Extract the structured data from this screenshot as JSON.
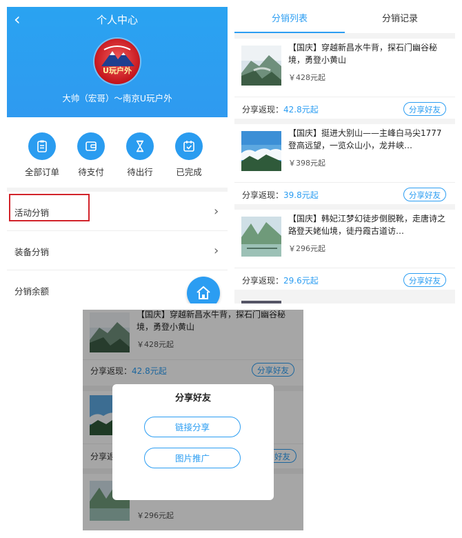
{
  "profile": {
    "back_icon": "chevron-left-icon",
    "title": "个人中心",
    "logo_text": "U玩户外",
    "username": "大帅（宏哥）～南京U玩户外",
    "orders": [
      {
        "label": "全部订单",
        "icon": "clipboard-icon"
      },
      {
        "label": "待支付",
        "icon": "wallet-icon"
      },
      {
        "label": "待出行",
        "icon": "hourglass-icon"
      },
      {
        "label": "已完成",
        "icon": "check-calendar-icon"
      }
    ],
    "menu": [
      {
        "label": "活动分销"
      },
      {
        "label": "装备分销"
      },
      {
        "label": "分销余额"
      }
    ],
    "home_icon": "home-icon"
  },
  "distribution": {
    "tabs": [
      "分销列表",
      "分销记录"
    ],
    "active_tab": "分销列表",
    "rebate_label": "分享返现：",
    "share_button": "分享好友",
    "items": [
      {
        "title": "【国庆】穿越新昌水牛背，探石门幽谷秘境，勇登小黄山",
        "price": "￥428元起",
        "rebate": "42.8元起"
      },
      {
        "title": "【国庆】挺进大别山——主峰白马尖1777登高远望，一览众山小，龙井峡…",
        "price": "￥398元起",
        "rebate": "39.8元起"
      },
      {
        "title": "【国庆】韩妃江梦幻徒步倒脱靴，走唐诗之路登天姥仙境，徒丹霞古道访…",
        "price": "￥296元起",
        "rebate": "29.6元起"
      }
    ]
  },
  "share_modal": {
    "bg_item1_title": "【国庆】穿越新昌水牛背，探石门幽谷秘境，勇登小黄山",
    "bg_item1_price": "￥428元起",
    "bg_rebate_label": "分享返现：",
    "bg_rebate_value": "42.8元起",
    "bg_share_button": "分享好友",
    "bg_rebate_label_partial": "分享返",
    "bg_share_button_partial": "好友",
    "bg_item3_price": "￥296元起",
    "title": "分享好友",
    "link_share": "链接分享",
    "image_promo": "图片推广"
  },
  "colors": {
    "accent": "#2b9df2",
    "highlight": "#d2232a"
  }
}
